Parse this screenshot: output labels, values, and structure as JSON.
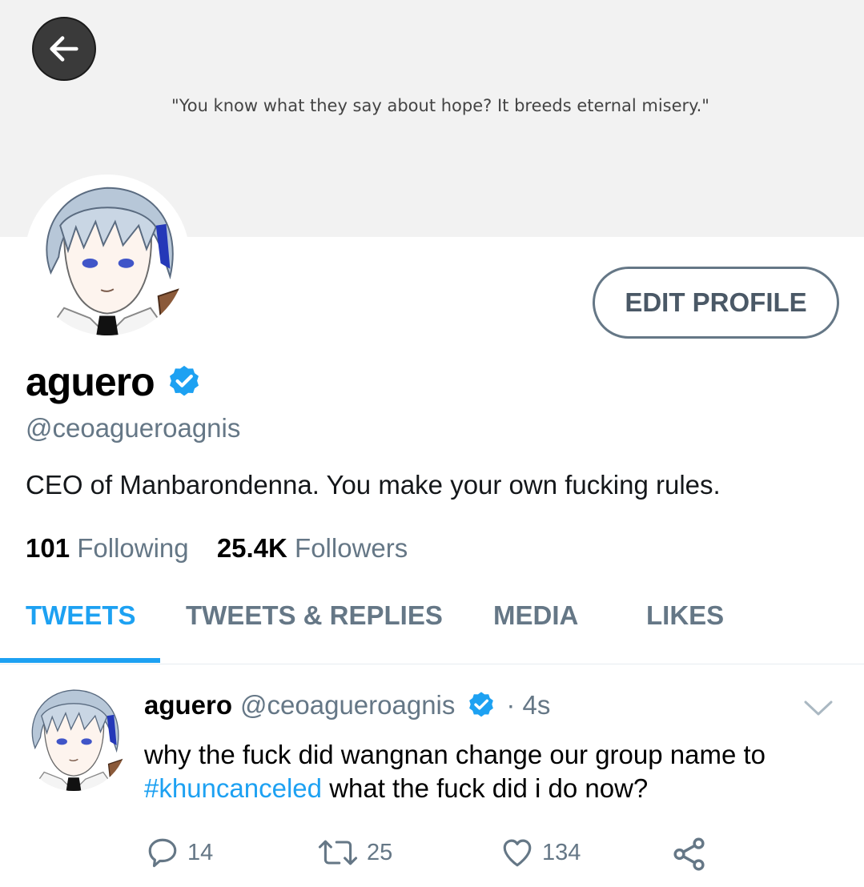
{
  "banner": {
    "quote": "\"You know what they say about hope? It breeds eternal misery.\""
  },
  "icons": {
    "back": "back-arrow-icon",
    "verified": "verified-badge-icon",
    "chevron": "chevron-down-icon",
    "reply": "reply-icon",
    "retweet": "retweet-icon",
    "like": "heart-icon",
    "share": "share-icon"
  },
  "colors": {
    "accent": "#1da1f2",
    "muted": "#657786",
    "banner": "#f2f2f2"
  },
  "profile": {
    "edit_label": "EDIT PROFILE",
    "name": "aguero",
    "handle": "@ceoagueroagnis",
    "bio": "CEO of Manbarondenna. You make your own fucking rules.",
    "following_count": "101",
    "following_label": "Following",
    "followers_count": "25.4K",
    "followers_label": "Followers"
  },
  "tabs": [
    {
      "label": "TWEETS",
      "active": true
    },
    {
      "label": "TWEETS & REPLIES",
      "active": false
    },
    {
      "label": "MEDIA",
      "active": false
    },
    {
      "label": "LIKES",
      "active": false
    }
  ],
  "tweet": {
    "name": "aguero",
    "handle": "@ceoagueroagnis",
    "time": "· 4s",
    "text_before": "why the fuck did wangnan change our group name to",
    "hashtag": "#khuncanceled",
    "text_after": "what the fuck did i do now?",
    "replies": "14",
    "retweets": "25",
    "likes": "134"
  }
}
